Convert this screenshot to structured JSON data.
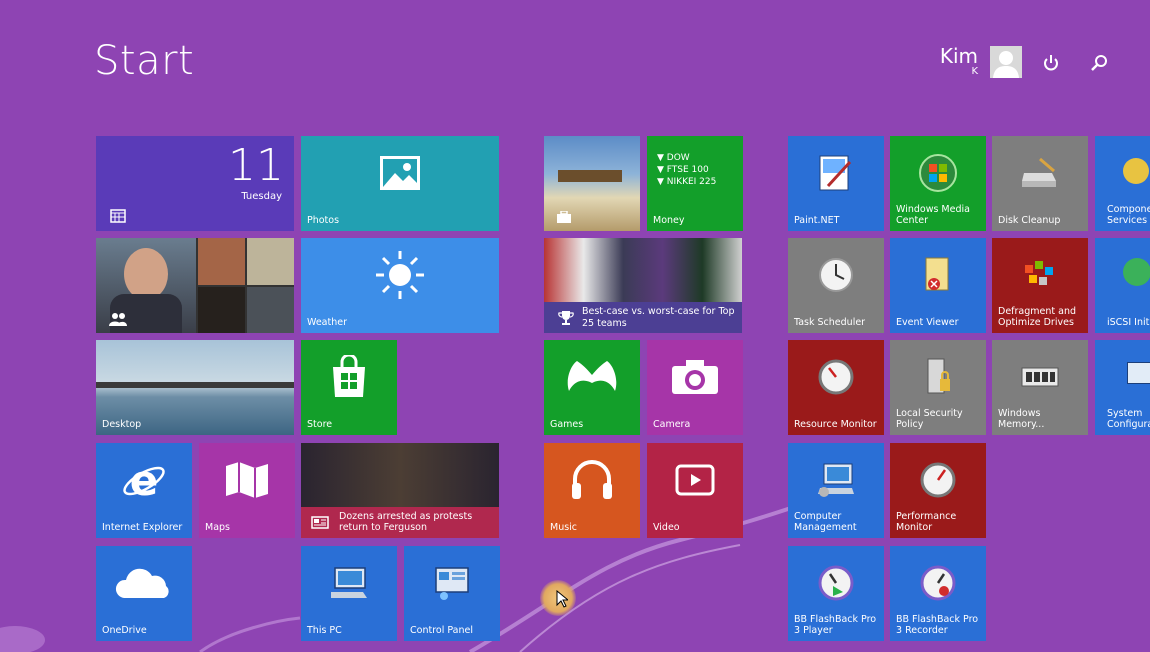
{
  "screen": {
    "title": "Start"
  },
  "user": {
    "name": "Kim",
    "sub": "K"
  },
  "tiles": {
    "calendar": {
      "date": "11",
      "day": "Tuesday"
    },
    "photos": "Photos",
    "money": {
      "label": "Money",
      "l1": "▼ DOW",
      "l2": "▼ FTSE 100",
      "l3": "▼ NIKKEI 225"
    },
    "weather": "Weather",
    "sports": {
      "headline": "Best-case vs. worst-case for Top 25 teams"
    },
    "desktop": "Desktop",
    "store": "Store",
    "games": "Games",
    "camera": "Camera",
    "ie": "Internet Explorer",
    "maps": "Maps",
    "news": {
      "headline": "Dozens arrested as protests return to Ferguson"
    },
    "music": "Music",
    "video": "Video",
    "onedrive": "OneDrive",
    "thispc": "This PC",
    "controlpanel": "Control Panel",
    "paintnet": "Paint.NET",
    "wmc": "Windows Media Center",
    "diskcleanup": "Disk Cleanup",
    "componentservices": "Component Services",
    "taskscheduler": "Task Scheduler",
    "eventviewer": "Event Viewer",
    "defrag": "Defragment and Optimize Drives",
    "iscsi": "iSCSI Initiator",
    "resourcemonitor": "Resource Monitor",
    "localsecurity": "Local Security Policy",
    "winmemory": "Windows Memory...",
    "sysconfig": "System Configuration",
    "computermgmt": "Computer Management",
    "perfmonitor": "Performance Monitor",
    "bbplayer": "BB FlashBack Pro 3 Player",
    "bbrecorder": "BB FlashBack Pro 3 Recorder"
  },
  "colors": {
    "background": "#8e44b3",
    "blue": "#2a6fd6",
    "green": "#139f2a",
    "magenta": "#a635a8",
    "teal": "#22a0b2",
    "red": "#9a1a1a",
    "gray": "#7e7e7e",
    "orange": "#d6561f"
  }
}
